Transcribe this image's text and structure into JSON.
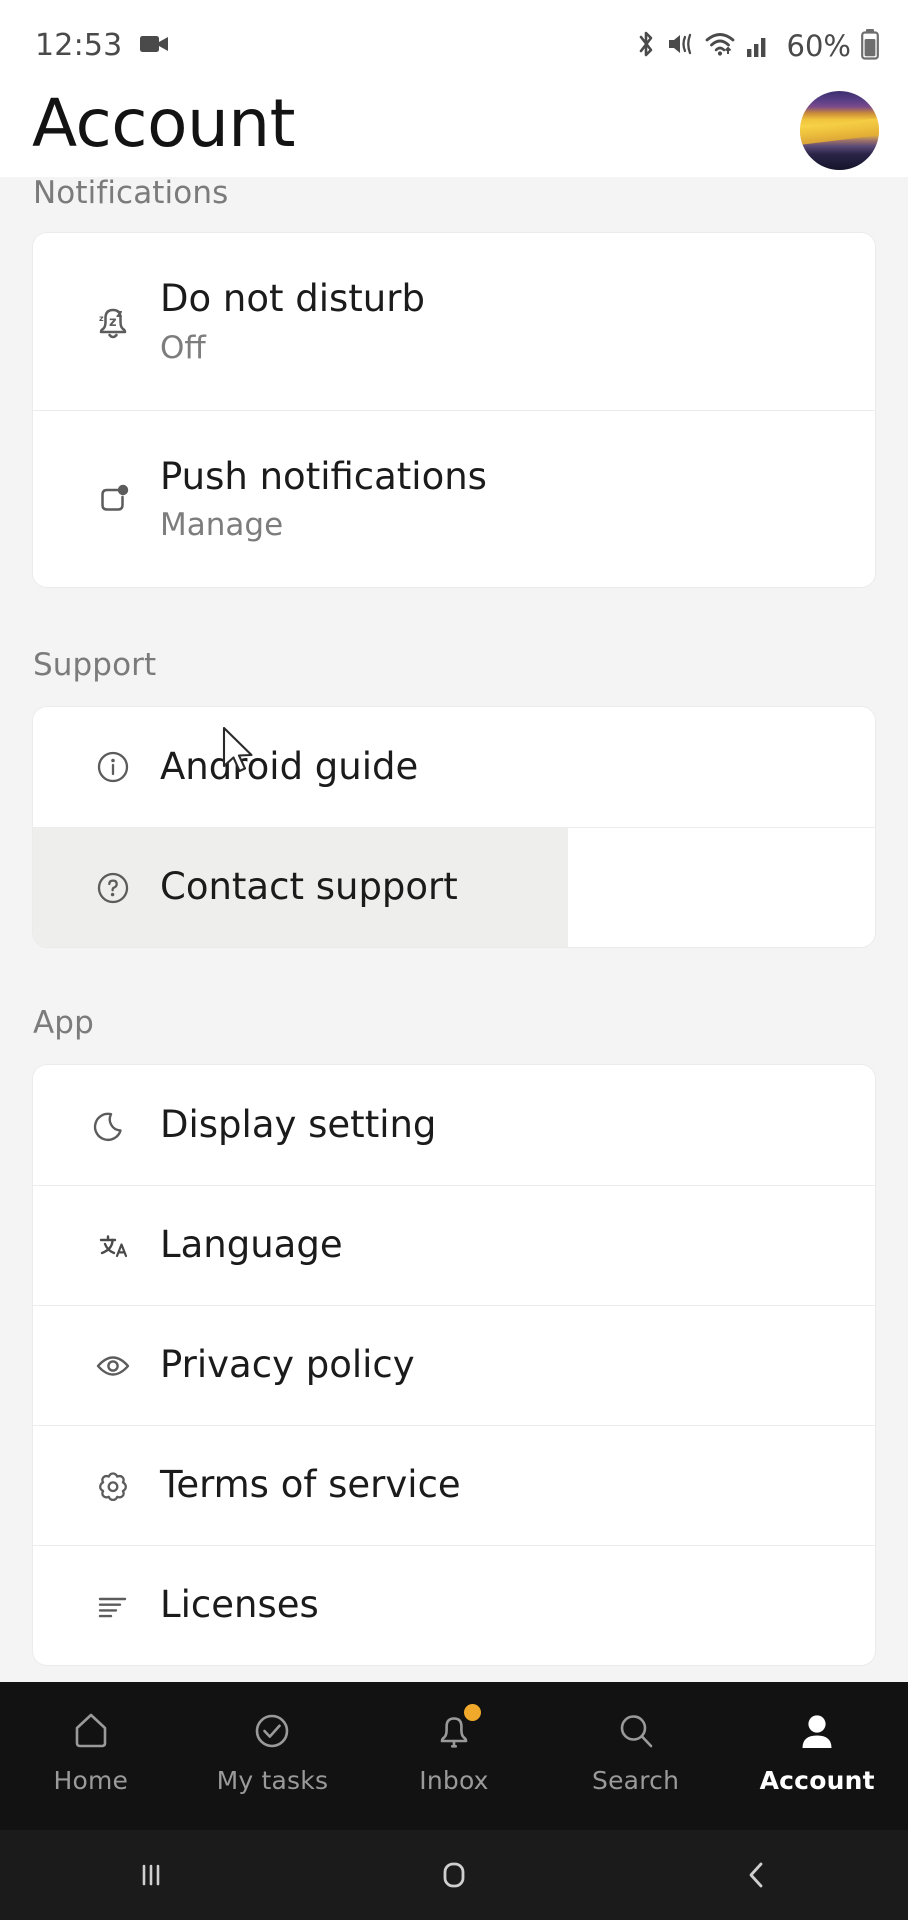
{
  "status_bar": {
    "time": "12:53",
    "battery_percent": "60%",
    "icons": [
      "screen-record-icon",
      "bluetooth-icon",
      "mute-vibrate-icon",
      "wifi-icon",
      "cellular-signal-icon",
      "battery-icon"
    ]
  },
  "header": {
    "title": "Account",
    "avatar_name": "profile-avatar"
  },
  "sections": [
    {
      "header": "Notifications",
      "rows": [
        {
          "icon": "do-not-disturb-bell-icon",
          "title": "Do not disturb",
          "subtitle": "Off",
          "state": "normal"
        },
        {
          "icon": "push-notification-icon",
          "title": "Push notifications",
          "subtitle": "Manage",
          "state": "normal"
        }
      ]
    },
    {
      "header": "Support",
      "rows": [
        {
          "icon": "info-circle-icon",
          "title": "Android guide",
          "subtitle": "",
          "state": "normal"
        },
        {
          "icon": "question-circle-icon",
          "title": "Contact support",
          "subtitle": "",
          "state": "pressed"
        }
      ]
    },
    {
      "header": "App",
      "rows": [
        {
          "icon": "moon-icon",
          "title": "Display setting",
          "subtitle": "",
          "state": "normal"
        },
        {
          "icon": "translate-icon",
          "title": "Language",
          "subtitle": "",
          "state": "normal"
        },
        {
          "icon": "eye-icon",
          "title": "Privacy policy",
          "subtitle": "",
          "state": "normal"
        },
        {
          "icon": "gear-icon",
          "title": "Terms of service",
          "subtitle": "",
          "state": "normal"
        },
        {
          "icon": "list-lines-icon",
          "title": "Licenses",
          "subtitle": "",
          "state": "normal"
        }
      ]
    }
  ],
  "bottom_nav": {
    "items": [
      {
        "label": "Home",
        "icon": "home-icon",
        "active": false,
        "badge": false
      },
      {
        "label": "My tasks",
        "icon": "check-circle-icon",
        "active": false,
        "badge": false
      },
      {
        "label": "Inbox",
        "icon": "bell-icon",
        "active": false,
        "badge": true
      },
      {
        "label": "Search",
        "icon": "search-icon",
        "active": false,
        "badge": false
      },
      {
        "label": "Account",
        "icon": "person-icon",
        "active": true,
        "badge": false
      }
    ]
  },
  "system_nav": {
    "recents_label": "recents-button",
    "home_label": "home-button",
    "back_label": "back-button"
  },
  "colors": {
    "page_bg": "#f4f4f4",
    "card_bg": "#ffffff",
    "nav_bg": "#121212",
    "sysnav_bg": "#1b1b1b",
    "badge": "#f0a92a",
    "muted_text": "#7d7d7d",
    "primary_text": "#1b1b1b"
  }
}
